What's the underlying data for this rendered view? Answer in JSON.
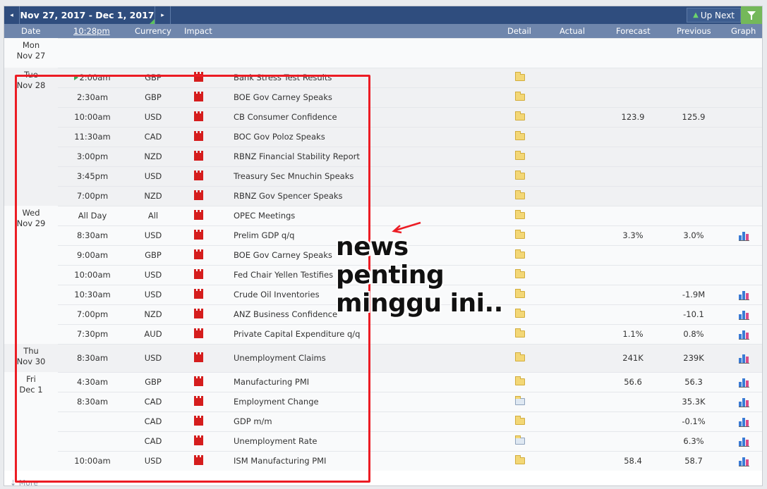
{
  "toolbar": {
    "prev_label": "◂",
    "week_range": "Nov 27, 2017 - Dec 1, 2017",
    "next_label": "▸",
    "up_next_label": "Up Next"
  },
  "columns": {
    "date": "Date",
    "time": "10:28pm",
    "currency": "Currency",
    "impact": "Impact",
    "detail": "Detail",
    "actual": "Actual",
    "forecast": "Forecast",
    "previous": "Previous",
    "graph": "Graph"
  },
  "days": [
    {
      "dow": "Mon",
      "date": "Nov 27"
    },
    {
      "dow": "Tue",
      "date": "Nov 28"
    },
    {
      "dow": "Wed",
      "date": "Nov 29"
    },
    {
      "dow": "Thu",
      "date": "Nov 30"
    },
    {
      "dow": "Fri",
      "date": "Dec 1"
    }
  ],
  "events": [
    {
      "time": "2:00am",
      "currency": "GBP",
      "impact": "high",
      "event": "Bank Stress Test Results",
      "forecast": "",
      "previous": "",
      "graph": false,
      "detail": "folder"
    },
    {
      "time": "2:30am",
      "currency": "GBP",
      "impact": "high",
      "event": "BOE Gov Carney Speaks",
      "forecast": "",
      "previous": "",
      "graph": false,
      "detail": "folder"
    },
    {
      "time": "10:00am",
      "currency": "USD",
      "impact": "high",
      "event": "CB Consumer Confidence",
      "forecast": "123.9",
      "previous": "125.9",
      "graph": false,
      "detail": "folder"
    },
    {
      "time": "11:30am",
      "currency": "CAD",
      "impact": "high",
      "event": "BOC Gov Poloz Speaks",
      "forecast": "",
      "previous": "",
      "graph": false,
      "detail": "folder"
    },
    {
      "time": "3:00pm",
      "currency": "NZD",
      "impact": "high",
      "event": "RBNZ Financial Stability Report",
      "forecast": "",
      "previous": "",
      "graph": false,
      "detail": "folder"
    },
    {
      "time": "3:45pm",
      "currency": "USD",
      "impact": "high",
      "event": "Treasury Sec Mnuchin Speaks",
      "forecast": "",
      "previous": "",
      "graph": false,
      "detail": "folder"
    },
    {
      "time": "7:00pm",
      "currency": "NZD",
      "impact": "high",
      "event": "RBNZ Gov Spencer Speaks",
      "forecast": "",
      "previous": "",
      "graph": false,
      "detail": "folder"
    },
    {
      "time": "All Day",
      "currency": "All",
      "impact": "high",
      "event": "OPEC Meetings",
      "forecast": "",
      "previous": "",
      "graph": false,
      "detail": "folder"
    },
    {
      "time": "8:30am",
      "currency": "USD",
      "impact": "high",
      "event": "Prelim GDP q/q",
      "forecast": "3.3%",
      "previous": "3.0%",
      "graph": true,
      "detail": "folder"
    },
    {
      "time": "9:00am",
      "currency": "GBP",
      "impact": "high",
      "event": "BOE Gov Carney Speaks",
      "forecast": "",
      "previous": "",
      "graph": false,
      "detail": "folder"
    },
    {
      "time": "10:00am",
      "currency": "USD",
      "impact": "high",
      "event": "Fed Chair Yellen Testifies",
      "forecast": "",
      "previous": "",
      "graph": false,
      "detail": "folder"
    },
    {
      "time": "10:30am",
      "currency": "USD",
      "impact": "high",
      "event": "Crude Oil Inventories",
      "forecast": "",
      "previous": "-1.9M",
      "graph": true,
      "detail": "folder"
    },
    {
      "time": "7:00pm",
      "currency": "NZD",
      "impact": "high",
      "event": "ANZ Business Confidence",
      "forecast": "",
      "previous": "-10.1",
      "graph": true,
      "detail": "folder"
    },
    {
      "time": "7:30pm",
      "currency": "AUD",
      "impact": "high",
      "event": "Private Capital Expenditure q/q",
      "forecast": "1.1%",
      "previous": "0.8%",
      "graph": true,
      "detail": "folder"
    },
    {
      "time": "8:30am",
      "currency": "USD",
      "impact": "high",
      "event": "Unemployment Claims",
      "forecast": "241K",
      "previous": "239K",
      "graph": true,
      "detail": "folder"
    },
    {
      "time": "4:30am",
      "currency": "GBP",
      "impact": "high",
      "event": "Manufacturing PMI",
      "forecast": "56.6",
      "previous": "56.3",
      "graph": true,
      "detail": "folder"
    },
    {
      "time": "8:30am",
      "currency": "CAD",
      "impact": "high",
      "event": "Employment Change",
      "forecast": "",
      "previous": "35.3K",
      "graph": true,
      "detail": "special"
    },
    {
      "time": "",
      "currency": "CAD",
      "impact": "high",
      "event": "GDP m/m",
      "forecast": "",
      "previous": "-0.1%",
      "graph": true,
      "detail": "folder"
    },
    {
      "time": "",
      "currency": "CAD",
      "impact": "high",
      "event": "Unemployment Rate",
      "forecast": "",
      "previous": "6.3%",
      "graph": true,
      "detail": "special"
    },
    {
      "time": "10:00am",
      "currency": "USD",
      "impact": "high",
      "event": "ISM Manufacturing PMI",
      "forecast": "58.4",
      "previous": "58.7",
      "graph": true,
      "detail": "folder"
    }
  ],
  "footer": {
    "more_label": "More"
  },
  "annotation": {
    "line1": "news penting",
    "line2": "minggu ini.."
  },
  "colors": {
    "highlight": "#ec1c24",
    "impact_high": "#d51d1d",
    "header_bg": "#2f4d7e"
  }
}
